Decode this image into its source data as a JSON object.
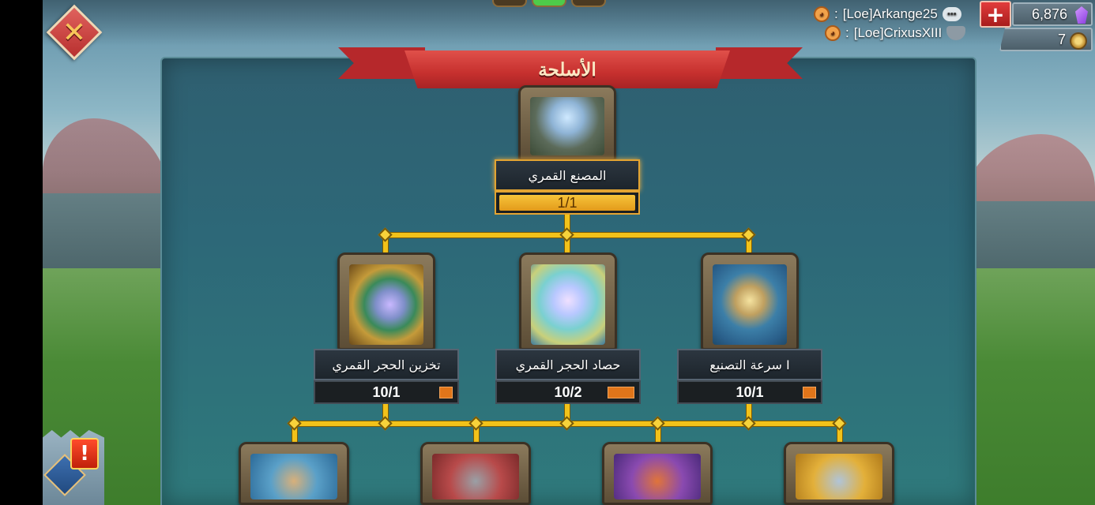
{
  "header": {
    "title": "الأسلحة",
    "close_icon": "close-icon",
    "page_indicator": {
      "count": 3,
      "active": 2
    }
  },
  "players": [
    {
      "name": "[Loe]Arkange25",
      "prefix": ":",
      "icon": "speech-bubble-icon"
    },
    {
      "name": "[Loe]CrixusXIII",
      "prefix": ":",
      "icon": "shield-wings-icon"
    }
  ],
  "resources": {
    "gems": "6,876",
    "gem_icon": "purple-gem-icon",
    "add_icon": "plus-icon",
    "tokens": "7",
    "token_icon": "gold-medal-icon"
  },
  "tree": {
    "root": {
      "label": "المصنع القمري",
      "progress": "1/1",
      "icon": "lunar-foundry-icon"
    },
    "tier2": [
      {
        "label": "تخزين الحجر القمري",
        "progress": "10/1",
        "icon": "moonstone-chest-icon"
      },
      {
        "label": "حصاد الحجر القمري",
        "progress": "10/2",
        "icon": "moonstones-icon"
      },
      {
        "label": "سرعة التصنيع I",
        "progress": "10/1",
        "icon": "shield-speed-icon"
      }
    ],
    "tier3": [
      {
        "icon": "cavalry-icon"
      },
      {
        "icon": "infantry-icon"
      },
      {
        "icon": "siege-icon"
      },
      {
        "icon": "soldier-icon"
      }
    ]
  },
  "colors": {
    "connector": "#f2c21a",
    "banner": "#c6302e",
    "progress_fill": "#f2b02a",
    "accent_square": "#e0751a"
  },
  "alert_icon": "alert-exclamation-icon"
}
